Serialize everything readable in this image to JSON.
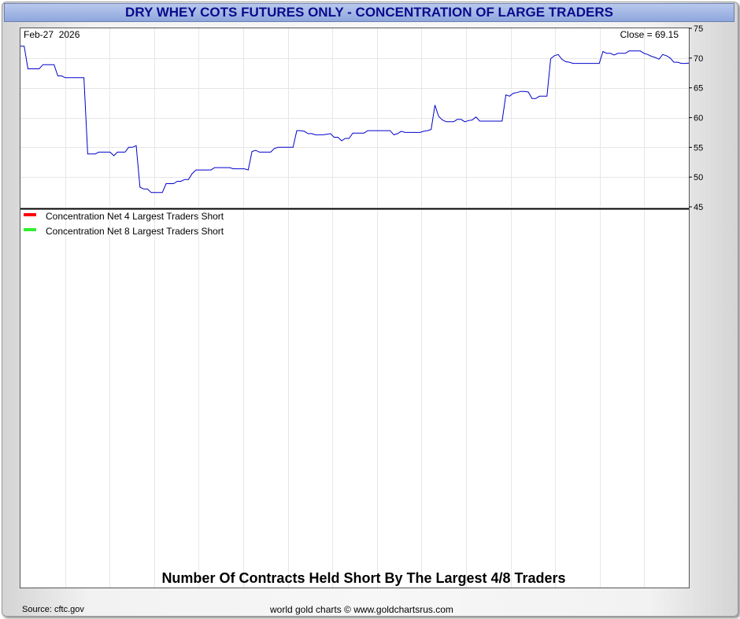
{
  "title": "DRY WHEY COTS FUTURES ONLY - CONCENTRATION OF LARGE TRADERS",
  "date_label": "Feb-27  2026",
  "close_label": "Close = 69.15",
  "lower_title": "Number Of Contracts Held Short By The Largest 4/8 Traders",
  "footer_source": "Source: cftc.gov",
  "footer_credit": "world gold charts © www.goldchartsrus.com",
  "colors": {
    "price_line": "#0000cc",
    "net4": "#ff0000",
    "net8": "#33ee33",
    "title_text": "#0a0a8c"
  },
  "chart_data": [
    {
      "type": "line",
      "ylim": [
        45,
        75
      ],
      "yticks": [
        45,
        50,
        55,
        60,
        65,
        70,
        75
      ],
      "grid": true,
      "series": [
        {
          "values": [
            72.0,
            72.0,
            68.2,
            68.2,
            68.2,
            68.2,
            68.9,
            68.9,
            68.9,
            68.9,
            67.0,
            67.0,
            66.7,
            66.7,
            66.7,
            66.7,
            66.7,
            66.7,
            53.9,
            53.9,
            53.9,
            54.2,
            54.2,
            54.2,
            54.2,
            53.6,
            54.2,
            54.2,
            54.2,
            55.0,
            55.0,
            55.3,
            48.3,
            48.0,
            48.0,
            47.4,
            47.4,
            47.4,
            47.4,
            48.9,
            48.9,
            48.9,
            49.3,
            49.3,
            49.6,
            49.6,
            50.6,
            51.2,
            51.2,
            51.2,
            51.2,
            51.2,
            51.6,
            51.6,
            51.6,
            51.6,
            51.6,
            51.4,
            51.4,
            51.4,
            51.4,
            51.2,
            54.3,
            54.5,
            54.2,
            54.2,
            54.2,
            54.2,
            54.8,
            55.0,
            55.0,
            55.0,
            55.0,
            55.0,
            57.8,
            57.8,
            57.7,
            57.3,
            57.3,
            57.1,
            57.1,
            57.1,
            57.2,
            57.3,
            56.7,
            56.7,
            56.1,
            56.5,
            56.5,
            57.4,
            57.4,
            57.4,
            57.4,
            57.8,
            57.8,
            57.8,
            57.8,
            57.8,
            57.8,
            57.8,
            57.1,
            57.3,
            57.7,
            57.5,
            57.5,
            57.5,
            57.5,
            57.5,
            57.7,
            57.8,
            58.0,
            62.1,
            60.2,
            59.6,
            59.3,
            59.3,
            59.3,
            59.7,
            59.7,
            59.3,
            59.5,
            59.6,
            60.1,
            59.4,
            59.4,
            59.4,
            59.4,
            59.4,
            59.4,
            59.4,
            63.8,
            63.6,
            64.1,
            64.2,
            64.4,
            64.4,
            64.3,
            63.2,
            63.2,
            63.6,
            63.6,
            63.6,
            69.9,
            70.4,
            70.6,
            69.8,
            69.4,
            69.3,
            69.1,
            69.1,
            69.1,
            69.1,
            69.1,
            69.1,
            69.1,
            69.1,
            71.1,
            70.8,
            70.8,
            70.5,
            70.8,
            70.8,
            70.8,
            71.2,
            71.2,
            71.2,
            71.2,
            70.8,
            70.6,
            70.3,
            70.1,
            69.8,
            70.6,
            70.4,
            70.0,
            69.3,
            69.3,
            69.1,
            69.1,
            69.15
          ]
        }
      ]
    },
    {
      "type": "line",
      "title": "Number Of Contracts Held Short By The Largest 4/8 Traders",
      "series": [
        {
          "name": "Concentration Net 4 Largest Traders Short",
          "values": []
        },
        {
          "name": "Concentration Net 8 Largest Traders Short",
          "values": []
        }
      ]
    }
  ]
}
